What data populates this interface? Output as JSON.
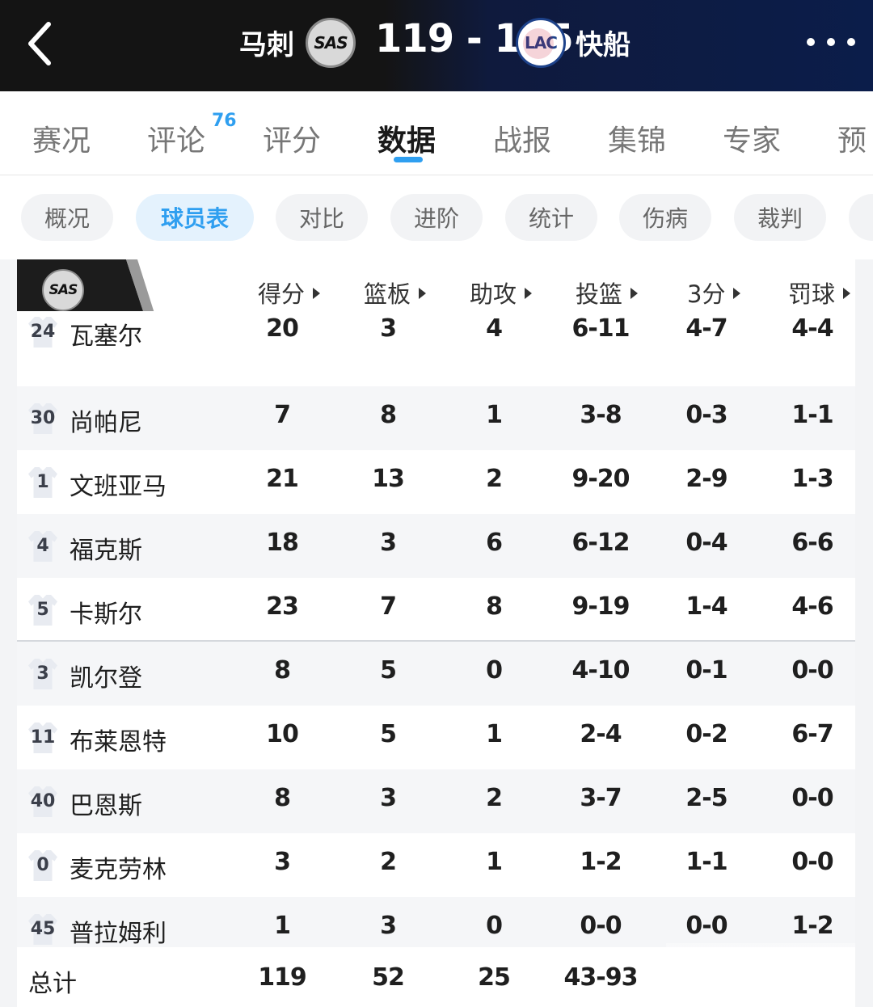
{
  "header": {
    "home_name": "马刺",
    "home_logo_text": "SAS",
    "score": "119 - 115",
    "away_logo_text": "LAC",
    "away_name": "快船"
  },
  "main_tabs": [
    {
      "label": "赛况",
      "badge": ""
    },
    {
      "label": "评论",
      "badge": "76"
    },
    {
      "label": "评分",
      "badge": ""
    },
    {
      "label": "数据",
      "badge": ""
    },
    {
      "label": "战报",
      "badge": ""
    },
    {
      "label": "集锦",
      "badge": ""
    },
    {
      "label": "专家",
      "badge": ""
    },
    {
      "label": "预",
      "badge": ""
    }
  ],
  "active_main_tab": "数据",
  "sub_tabs": [
    "概况",
    "球员表",
    "对比",
    "进阶",
    "统计",
    "伤病",
    "裁判"
  ],
  "active_sub_tab": "球员表",
  "table": {
    "team_logo_text": "SAS",
    "columns": [
      "得分",
      "篮板",
      "助攻",
      "投篮",
      "3分",
      "罚球"
    ],
    "players": [
      {
        "number": "24",
        "name": "瓦塞尔",
        "stats": [
          "20",
          "3",
          "4",
          "6-11",
          "4-7",
          "4-4"
        ]
      },
      {
        "number": "30",
        "name": "尚帕尼",
        "stats": [
          "7",
          "8",
          "1",
          "3-8",
          "0-3",
          "1-1"
        ]
      },
      {
        "number": "1",
        "name": "文班亚马",
        "stats": [
          "21",
          "13",
          "2",
          "9-20",
          "2-9",
          "1-3"
        ]
      },
      {
        "number": "4",
        "name": "福克斯",
        "stats": [
          "18",
          "3",
          "6",
          "6-12",
          "0-4",
          "6-6"
        ]
      },
      {
        "number": "5",
        "name": "卡斯尔",
        "stats": [
          "23",
          "7",
          "8",
          "9-19",
          "1-4",
          "4-6"
        ]
      },
      {
        "number": "3",
        "name": "凯尔登",
        "stats": [
          "8",
          "5",
          "0",
          "4-10",
          "0-1",
          "0-0"
        ]
      },
      {
        "number": "11",
        "name": "布莱恩特",
        "stats": [
          "10",
          "5",
          "1",
          "2-4",
          "0-2",
          "6-7"
        ]
      },
      {
        "number": "40",
        "name": "巴恩斯",
        "stats": [
          "8",
          "3",
          "2",
          "3-7",
          "2-5",
          "0-0"
        ]
      },
      {
        "number": "0",
        "name": "麦克劳林",
        "stats": [
          "3",
          "2",
          "1",
          "1-2",
          "1-1",
          "0-0"
        ]
      },
      {
        "number": "45",
        "name": "普拉姆利",
        "stats": [
          "1",
          "3",
          "0",
          "0-0",
          "0-0",
          "1-2"
        ]
      }
    ],
    "total": {
      "label": "总计",
      "stats": [
        "119",
        "52",
        "25",
        "43-93"
      ]
    }
  },
  "colors": {
    "accent": "#2f9ff0",
    "header_dark": "#141414",
    "header_navy": "#0b1d4a"
  }
}
